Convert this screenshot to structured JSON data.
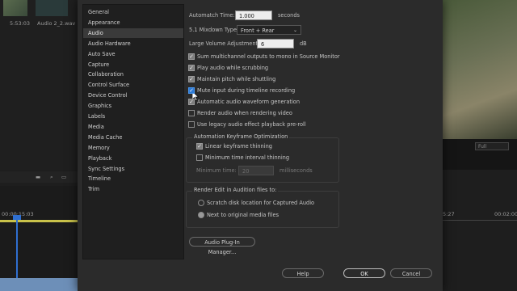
{
  "background": {
    "clip_time": "5:53:03",
    "clip_name": "Audio 2_2.wav",
    "timecode_left": "00:00:15:03",
    "timecode_right_a": "5:27",
    "timecode_right_b": "00:02:00:",
    "zoom_select": "Full"
  },
  "categories": [
    {
      "label": "General",
      "selected": false
    },
    {
      "label": "Appearance",
      "selected": false
    },
    {
      "label": "Audio",
      "selected": true
    },
    {
      "label": "Audio Hardware",
      "selected": false
    },
    {
      "label": "Auto Save",
      "selected": false
    },
    {
      "label": "Capture",
      "selected": false
    },
    {
      "label": "Collaboration",
      "selected": false
    },
    {
      "label": "Control Surface",
      "selected": false
    },
    {
      "label": "Device Control",
      "selected": false
    },
    {
      "label": "Graphics",
      "selected": false
    },
    {
      "label": "Labels",
      "selected": false
    },
    {
      "label": "Media",
      "selected": false
    },
    {
      "label": "Media Cache",
      "selected": false
    },
    {
      "label": "Memory",
      "selected": false
    },
    {
      "label": "Playback",
      "selected": false
    },
    {
      "label": "Sync Settings",
      "selected": false
    },
    {
      "label": "Timeline",
      "selected": false
    },
    {
      "label": "Trim",
      "selected": false
    }
  ],
  "audio": {
    "automatch_label": "Automatch Time:",
    "automatch_value": "1.000",
    "automatch_unit": "seconds",
    "mixdown_label": "5.1 Mixdown Type:",
    "mixdown_value": "Front + Rear",
    "volume_label": "Large Volume Adjustment:",
    "volume_value": "6",
    "volume_unit": "dB",
    "options": [
      {
        "label": "Sum multichannel outputs to mono in Source Monitor",
        "checked": true
      },
      {
        "label": "Play audio while scrubbing",
        "checked": true
      },
      {
        "label": "Maintain pitch while shuttling",
        "checked": true
      },
      {
        "label": "Mute input during timeline recording",
        "checked": true
      },
      {
        "label": "Automatic audio waveform generation",
        "checked": true
      },
      {
        "label": "Render audio when rendering video",
        "checked": false
      },
      {
        "label": "Use legacy audio effect playback pre-roll",
        "checked": false
      }
    ],
    "keyframe_group_title": "Automation Keyframe Optimization",
    "linear_thinning_label": "Linear keyframe thinning",
    "minimum_interval_label": "Minimum time interval thinning",
    "minimum_time_label": "Minimum time:",
    "minimum_time_value": "20",
    "minimum_time_unit": "milliseconds",
    "render_group_title": "Render Edit in Audition files to:",
    "radio_scratch": "Scratch disk location for Captured Audio",
    "radio_next": "Next to original media files",
    "plugin_button": "Audio Plug-In Manager..."
  },
  "footer": {
    "help": "Help",
    "ok": "OK",
    "cancel": "Cancel"
  },
  "colors": {
    "accent_check": "#2d7bd8",
    "playhead": "#2f6fd0"
  }
}
